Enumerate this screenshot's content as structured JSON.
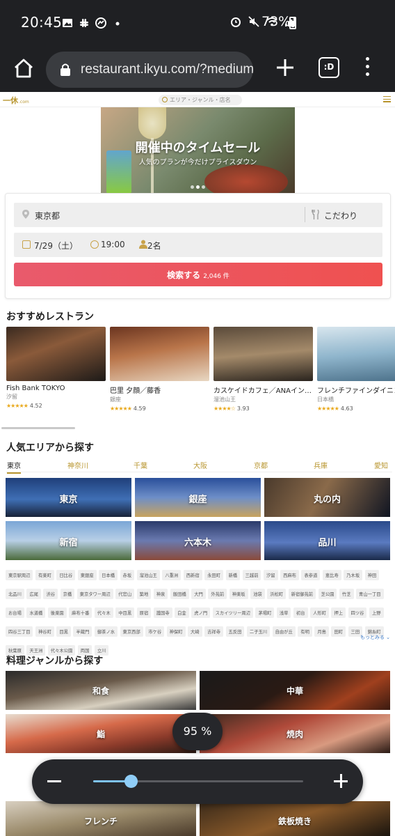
{
  "status_bar": {
    "time": "20:45",
    "battery": "73%",
    "left_icons": [
      "gallery-icon",
      "slack-icon",
      "messenger-icon",
      "dot-icon"
    ],
    "right_icons": [
      "alarm-icon",
      "mute-icon",
      "wifi-icon",
      "signal-icon",
      "battery-icon"
    ]
  },
  "browser": {
    "url": "restaurant.ikyu.com/?medium",
    "tabs_label": ":D"
  },
  "site": {
    "logo": "一休",
    "logo_suffix": ".com",
    "search_placeholder": "エリア・ジャンル・店名"
  },
  "hero": {
    "title": "開催中のタイムセール",
    "subtitle": "人気のプランが今だけプライスダウン"
  },
  "search": {
    "location": "東京都",
    "preference": "こだわり",
    "date": "7/29（土）",
    "time": "19:00",
    "people": "2名",
    "button_label": "検索する",
    "button_count": "2,046 件"
  },
  "recommended": {
    "title": "おすすめレストラン",
    "items": [
      {
        "name": "Fish Bank TOKYO",
        "area": "汐留",
        "rating": "4.52",
        "stars": "★★★★★"
      },
      {
        "name": "巴里 夕顔／藤香",
        "area": "銀座",
        "rating": "4.59",
        "stars": "★★★★★"
      },
      {
        "name": "カスケイドカフェ／ANAイン…",
        "area": "溜池山王",
        "rating": "3.93",
        "stars": "★★★★☆"
      },
      {
        "name": "フレンチファインダイニン",
        "area": "日本橋",
        "rating": "4.63",
        "stars": "★★★★★"
      }
    ]
  },
  "areas": {
    "title": "人気エリアから探す",
    "tabs": [
      "東京",
      "神奈川",
      "千葉",
      "大阪",
      "京都",
      "兵庫",
      "愛知"
    ],
    "tiles": [
      "東京",
      "銀座",
      "丸の内",
      "新宿",
      "六本木",
      "品川"
    ],
    "chips": [
      "東京駅周辺",
      "有楽町",
      "日比谷",
      "東銀座",
      "日本橋",
      "赤坂",
      "溜池山王",
      "八重洲",
      "西新宿",
      "永田町",
      "新橋",
      "三越前",
      "汐留",
      "西麻布",
      "表参道",
      "恵比寿",
      "乃木坂",
      "神田",
      "北品川",
      "広尾",
      "渋谷",
      "京橋",
      "東京タワー周辺",
      "代官山",
      "築地",
      "神泉",
      "飯田橋",
      "大門",
      "外苑前",
      "神楽坂",
      "池袋",
      "浜松町",
      "新宿御苑前",
      "芝公園",
      "竹芝",
      "青山一丁目",
      "お台場",
      "水道橋",
      "後楽園",
      "麻布十番",
      "代々木",
      "中目黒",
      "原宿",
      "護国寺",
      "白金",
      "虎ノ門",
      "スカイツリー周辺",
      "茅場町",
      "浅草",
      "初台",
      "人形町",
      "押上",
      "四ツ谷",
      "上野",
      "四谷三丁目",
      "神谷町",
      "目黒",
      "半蔵門",
      "御茶ノ水",
      "東京西部",
      "市ケ谷",
      "神保町",
      "大崎",
      "吉祥寺",
      "五反田",
      "二子玉川",
      "自由が丘",
      "有明",
      "月島",
      "田町",
      "三田",
      "錦糸町",
      "秋葉原",
      "天王洲",
      "代々木公園",
      "両国",
      "立川"
    ],
    "more": "もっとみる"
  },
  "genres": {
    "title": "料理ジャンルから探す",
    "tiles": [
      "和食",
      "中華",
      "鮨",
      "焼肉",
      "フレンチ",
      "鉄板焼き"
    ]
  },
  "zoom": {
    "label": "95 %",
    "level_fraction": 0.18
  }
}
